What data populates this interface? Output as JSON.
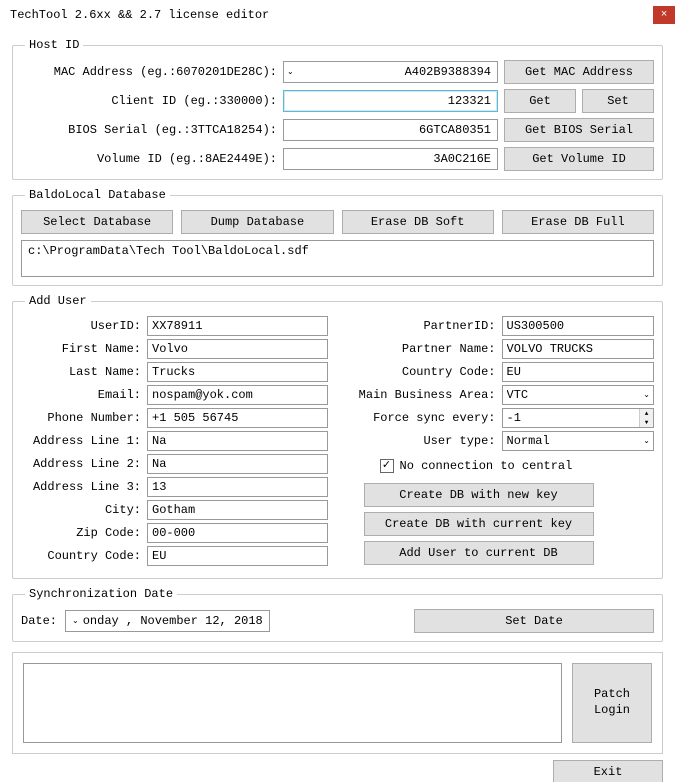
{
  "window": {
    "title": "TechTool 2.6xx && 2.7 license editor",
    "close": "×"
  },
  "hostid": {
    "legend": "Host ID",
    "mac": {
      "label": "MAC Address (eg.:6070201DE28C):",
      "value": "A402B9388394",
      "btn": "Get MAC Address"
    },
    "client": {
      "label": "Client ID (eg.:330000):",
      "value": "123321",
      "get": "Get",
      "set": "Set"
    },
    "bios": {
      "label": "BIOS Serial (eg.:3TTCA18254):",
      "value": "6GTCA80351",
      "btn": "Get BIOS Serial"
    },
    "volume": {
      "label": "Volume ID (eg.:8AE2449E):",
      "value": "3A0C216E",
      "btn": "Get Volume ID"
    }
  },
  "db": {
    "legend": "BaldoLocal Database",
    "select": "Select Database",
    "dump": "Dump Database",
    "erasesoft": "Erase DB Soft",
    "erasefull": "Erase DB Full",
    "path": "c:\\ProgramData\\Tech Tool\\BaldoLocal.sdf"
  },
  "adduser": {
    "legend": "Add User",
    "left": {
      "userid": {
        "label": "UserID:",
        "value": "XX78911"
      },
      "firstname": {
        "label": "First Name:",
        "value": "Volvo"
      },
      "lastname": {
        "label": "Last Name:",
        "value": "Trucks"
      },
      "email": {
        "label": "Email:",
        "value": "nospam@yok.com"
      },
      "phone": {
        "label": "Phone Number:",
        "value": "+1 505 56745"
      },
      "addr1": {
        "label": "Address Line 1:",
        "value": "Na"
      },
      "addr2": {
        "label": "Address Line 2:",
        "value": "Na"
      },
      "addr3": {
        "label": "Address Line 3:",
        "value": "13"
      },
      "city": {
        "label": "City:",
        "value": "Gotham"
      },
      "zip": {
        "label": "Zip Code:",
        "value": "00-000"
      },
      "country": {
        "label": "Country Code:",
        "value": "EU"
      }
    },
    "right": {
      "partnerid": {
        "label": "PartnerID:",
        "value": "US300500"
      },
      "partnername": {
        "label": "Partner Name:",
        "value": "VOLVO TRUCKS"
      },
      "countrycode": {
        "label": "Country Code:",
        "value": "EU"
      },
      "mba": {
        "label": "Main Business Area:",
        "value": "VTC"
      },
      "sync": {
        "label": "Force sync every:",
        "value": "-1"
      },
      "usertype": {
        "label": "User type:",
        "value": "Normal"
      },
      "noconn": {
        "label": "No connection to central",
        "checked": "✓"
      },
      "createnew": "Create DB with new key",
      "createcur": "Create DB with current key",
      "addusercur": "Add User to current DB"
    }
  },
  "syncdate": {
    "legend": "Synchronization Date",
    "label": "Date:",
    "value": "onday , November 12, 2018",
    "btn": "Set Date"
  },
  "footer": {
    "patch": "Patch\nLogin",
    "exit": "Exit"
  }
}
